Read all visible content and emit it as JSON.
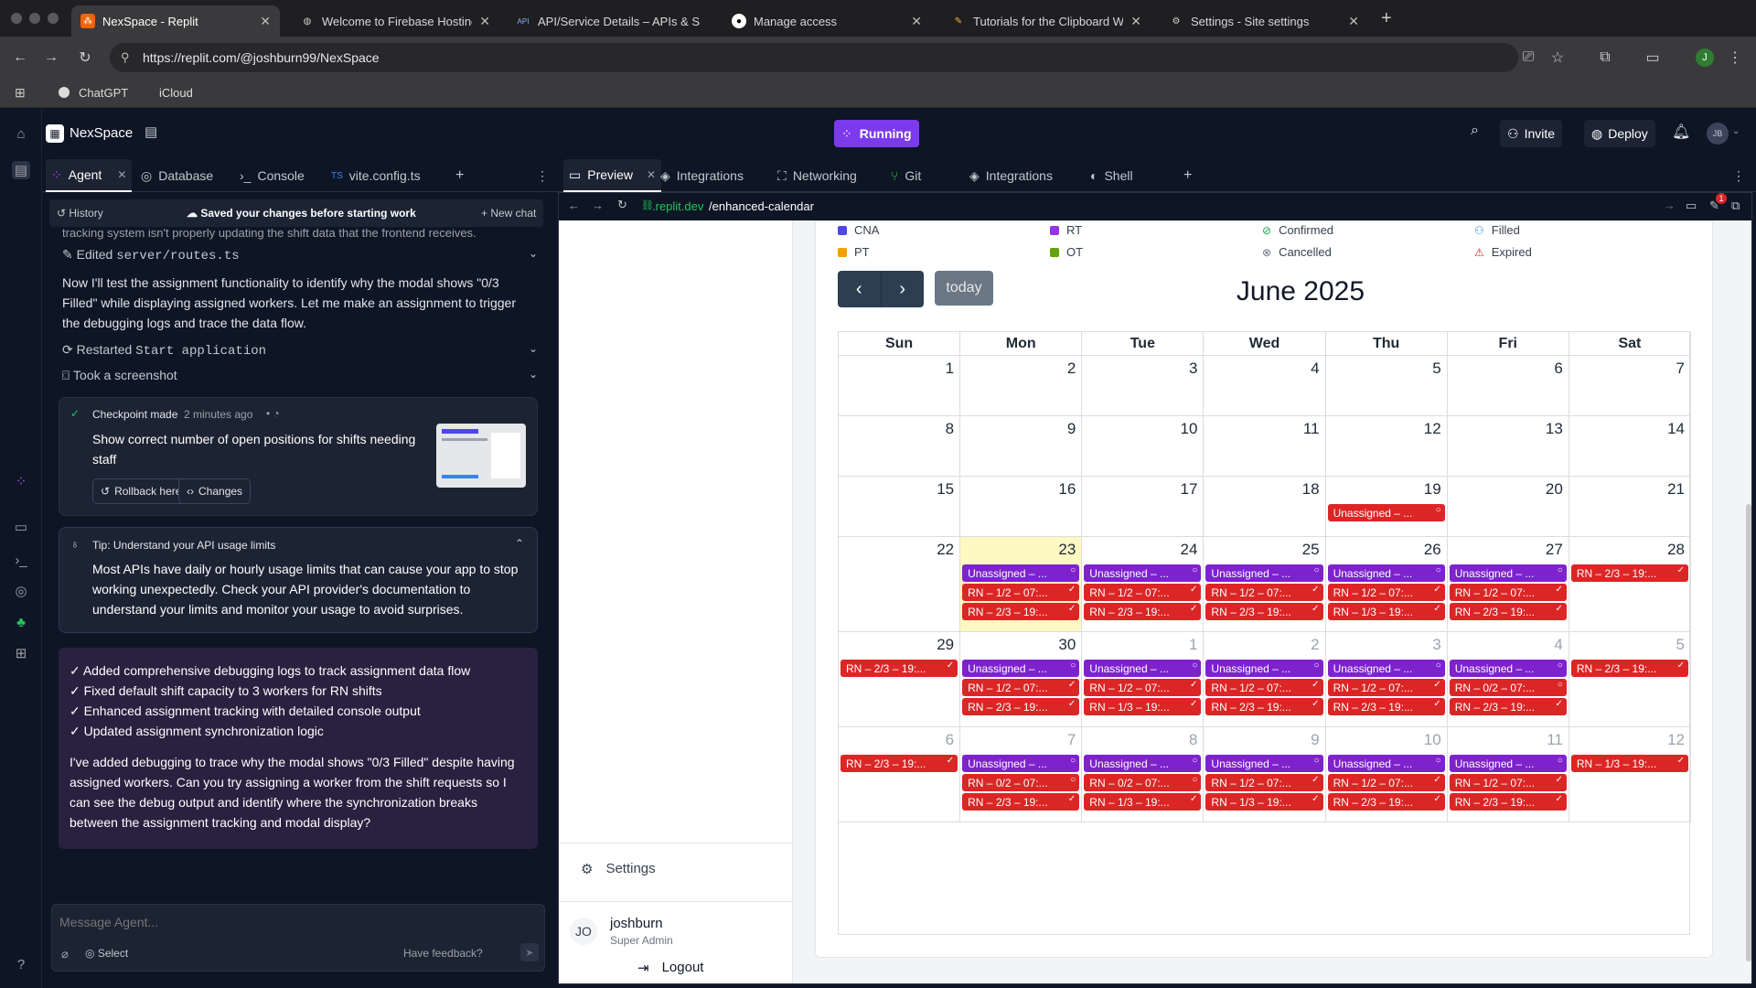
{
  "browser": {
    "tabs": [
      {
        "title": "NexSpace - Replit",
        "icon": "replit-favicon",
        "active": true
      },
      {
        "title": "Welcome to Firebase Hosting",
        "icon": "globe-icon"
      },
      {
        "title": "API/Service Details – APIs & S",
        "icon": "api-icon"
      },
      {
        "title": "Manage access",
        "icon": "github-icon"
      },
      {
        "title": "Tutorials for the Clipboard Wo",
        "icon": "tutorial-icon"
      },
      {
        "title": "Settings - Site settings",
        "icon": "gear-icon"
      }
    ],
    "url": "https://replit.com/@joshburn99/NexSpace",
    "bookmarks": [
      "ChatGPT",
      "iCloud"
    ],
    "profile_initial": "J"
  },
  "replit": {
    "project_name": "NexSpace",
    "run_status": "Running",
    "invite_label": "Invite",
    "deploy_label": "Deploy",
    "avatar_initials": "JB",
    "left_tabs": [
      "Agent",
      "Database",
      "Console",
      "vite.config.ts"
    ],
    "right_tabs": [
      "Preview",
      "Integrations",
      "Networking",
      "Git",
      "Integrations",
      "Shell"
    ]
  },
  "agent": {
    "history_label": "History",
    "saved_message": "Saved your changes before starting work",
    "new_chat_label": "New chat",
    "cutoff_text": "tracking system isn't properly updating the shift data that the frontend receives.",
    "edited_label": "Edited",
    "edited_file": "server/routes.ts",
    "paragraph1": "Now I'll test the assignment functionality to identify why the modal shows \"0/3 Filled\" while displaying assigned workers. Let me make an assignment to trigger the debugging logs and trace the data flow.",
    "restarted_label": "Restarted",
    "restarted_target": "Start application",
    "screenshot_label": "Took a screenshot",
    "checkpoint_label": "Checkpoint made",
    "checkpoint_time": "2 minutes ago",
    "checkpoint_text": "Show correct number of open positions for shifts needing staff",
    "rollback_label": "Rollback here",
    "changes_label": "Changes",
    "tip_title": "Tip: Understand your API usage limits",
    "tip_body": "Most APIs have daily or hourly usage limits that can cause your app to stop working unexpectedly. Check your API provider's documentation to understand your limits and monitor your usage to avoid surprises.",
    "summary_items": [
      "✓ Added comprehensive debugging logs to track assignment data flow",
      "✓ Fixed default shift capacity to 3 workers for RN shifts",
      "✓ Enhanced assignment tracking with detailed console output",
      "✓ Updated assignment synchronization logic"
    ],
    "summary_paragraph": "I've added debugging to trace why the modal shows \"0/3 Filled\" despite having assigned workers. Can you try assigning a worker from the shift requests so I can see the debug output and identify where the synchronization breaks between the assignment tracking and modal display?",
    "input_placeholder": "Message Agent...",
    "select_label": "Select",
    "feedback_label": "Have feedback?"
  },
  "preview": {
    "url_prefix": ".replit.dev",
    "url_path": "/enhanced-calendar",
    "sidebar": {
      "settings_label": "Settings",
      "user_initials": "JO",
      "user_name": "joshburn",
      "user_role": "Super Admin",
      "logout_label": "Logout"
    },
    "legend": [
      {
        "label": "CNA",
        "color": "#4f46e5"
      },
      {
        "label": "RT",
        "color": "#9333ea"
      },
      {
        "label": "Confirmed",
        "icon": "check-circle-icon"
      },
      {
        "label": "Filled",
        "icon": "user-check-icon"
      },
      {
        "label": "PT",
        "color": "#f59e0b"
      },
      {
        "label": "OT",
        "color": "#65a30d"
      },
      {
        "label": "Cancelled",
        "icon": "x-circle-icon"
      },
      {
        "label": "Expired",
        "icon": "warning-triangle-icon"
      }
    ],
    "calendar": {
      "title": "June 2025",
      "today_label": "today",
      "weekdays": [
        "Sun",
        "Mon",
        "Tue",
        "Wed",
        "Thu",
        "Fri",
        "Sat"
      ],
      "weeks": [
        {
          "days": [
            {
              "n": "1"
            },
            {
              "n": "2"
            },
            {
              "n": "3"
            },
            {
              "n": "4"
            },
            {
              "n": "5"
            },
            {
              "n": "6"
            },
            {
              "n": "7"
            }
          ]
        },
        {
          "days": [
            {
              "n": "8"
            },
            {
              "n": "9"
            },
            {
              "n": "10"
            },
            {
              "n": "11"
            },
            {
              "n": "12"
            },
            {
              "n": "13"
            },
            {
              "n": "14"
            }
          ]
        },
        {
          "days": [
            {
              "n": "15"
            },
            {
              "n": "16"
            },
            {
              "n": "17"
            },
            {
              "n": "18"
            },
            {
              "n": "19",
              "events": [
                {
                  "t": "Unassigned – ...",
                  "c": "red",
                  "m": "○"
                }
              ]
            },
            {
              "n": "20"
            },
            {
              "n": "21"
            }
          ]
        },
        {
          "days": [
            {
              "n": "22"
            },
            {
              "n": "23",
              "today": true,
              "events": [
                {
                  "t": "Unassigned – ...",
                  "c": "purple",
                  "m": "○"
                },
                {
                  "t": "RN – 1/2 – 07:...",
                  "c": "red",
                  "m": "✓"
                },
                {
                  "t": "RN – 2/3 – 19:...",
                  "c": "red",
                  "m": "✓"
                }
              ]
            },
            {
              "n": "24",
              "events": [
                {
                  "t": "Unassigned – ...",
                  "c": "purple",
                  "m": "○"
                },
                {
                  "t": "RN – 1/2 – 07:...",
                  "c": "red",
                  "m": "✓"
                },
                {
                  "t": "RN – 2/3 – 19:...",
                  "c": "red",
                  "m": "✓"
                }
              ]
            },
            {
              "n": "25",
              "events": [
                {
                  "t": "Unassigned – ...",
                  "c": "purple",
                  "m": "○"
                },
                {
                  "t": "RN – 1/2 – 07:...",
                  "c": "red",
                  "m": "✓"
                },
                {
                  "t": "RN – 2/3 – 19:...",
                  "c": "red",
                  "m": "✓"
                }
              ]
            },
            {
              "n": "26",
              "events": [
                {
                  "t": "Unassigned – ...",
                  "c": "purple",
                  "m": "○"
                },
                {
                  "t": "RN – 1/2 – 07:...",
                  "c": "red",
                  "m": "✓"
                },
                {
                  "t": "RN – 1/3 – 19:...",
                  "c": "red",
                  "m": "✓"
                }
              ]
            },
            {
              "n": "27",
              "events": [
                {
                  "t": "Unassigned – ...",
                  "c": "purple",
                  "m": "○"
                },
                {
                  "t": "RN – 1/2 – 07:...",
                  "c": "red",
                  "m": "✓"
                },
                {
                  "t": "RN – 2/3 – 19:...",
                  "c": "red",
                  "m": "✓"
                }
              ]
            },
            {
              "n": "28",
              "events": [
                {
                  "t": "RN – 2/3 – 19:...",
                  "c": "red",
                  "m": "✓"
                }
              ]
            }
          ]
        },
        {
          "days": [
            {
              "n": "29",
              "events": [
                {
                  "t": "RN – 2/3 – 19:...",
                  "c": "red",
                  "m": "✓"
                }
              ]
            },
            {
              "n": "30",
              "events": [
                {
                  "t": "Unassigned – ...",
                  "c": "purple",
                  "m": "○"
                },
                {
                  "t": "RN – 1/2 – 07:...",
                  "c": "red",
                  "m": "✓"
                },
                {
                  "t": "RN – 2/3 – 19:...",
                  "c": "red",
                  "m": "✓"
                }
              ]
            },
            {
              "n": "1",
              "muted": true,
              "events": [
                {
                  "t": "Unassigned – ...",
                  "c": "purple",
                  "m": "○"
                },
                {
                  "t": "RN – 1/2 – 07:...",
                  "c": "red",
                  "m": "✓"
                },
                {
                  "t": "RN – 1/3 – 19:...",
                  "c": "red",
                  "m": "✓"
                }
              ]
            },
            {
              "n": "2",
              "muted": true,
              "events": [
                {
                  "t": "Unassigned – ...",
                  "c": "purple",
                  "m": "○"
                },
                {
                  "t": "RN – 1/2 – 07:...",
                  "c": "red",
                  "m": "✓"
                },
                {
                  "t": "RN – 2/3 – 19:...",
                  "c": "red",
                  "m": "✓"
                }
              ]
            },
            {
              "n": "3",
              "muted": true,
              "events": [
                {
                  "t": "Unassigned – ...",
                  "c": "purple",
                  "m": "○"
                },
                {
                  "t": "RN – 1/2 – 07:...",
                  "c": "red",
                  "m": "✓"
                },
                {
                  "t": "RN – 2/3 – 19:...",
                  "c": "red",
                  "m": "✓"
                }
              ]
            },
            {
              "n": "4",
              "muted": true,
              "events": [
                {
                  "t": "Unassigned – ...",
                  "c": "purple",
                  "m": "○"
                },
                {
                  "t": "RN – 0/2 – 07:...",
                  "c": "red",
                  "m": "○"
                },
                {
                  "t": "RN – 2/3 – 19:...",
                  "c": "red",
                  "m": "✓"
                }
              ]
            },
            {
              "n": "5",
              "muted": true,
              "events": [
                {
                  "t": "RN – 2/3 – 19:...",
                  "c": "red",
                  "m": "✓"
                }
              ]
            }
          ]
        },
        {
          "days": [
            {
              "n": "6",
              "muted": true,
              "events": [
                {
                  "t": "RN – 2/3 – 19:...",
                  "c": "red",
                  "m": "✓"
                }
              ]
            },
            {
              "n": "7",
              "muted": true,
              "events": [
                {
                  "t": "Unassigned – ...",
                  "c": "purple",
                  "m": "○"
                },
                {
                  "t": "RN – 0/2 – 07:...",
                  "c": "red",
                  "m": "○"
                },
                {
                  "t": "RN – 2/3 – 19:...",
                  "c": "red",
                  "m": "✓"
                }
              ]
            },
            {
              "n": "8",
              "muted": true,
              "events": [
                {
                  "t": "Unassigned – ...",
                  "c": "purple",
                  "m": "○"
                },
                {
                  "t": "RN – 0/2 – 07:...",
                  "c": "red",
                  "m": "○"
                },
                {
                  "t": "RN – 1/3 – 19:...",
                  "c": "red",
                  "m": "✓"
                }
              ]
            },
            {
              "n": "9",
              "muted": true,
              "events": [
                {
                  "t": "Unassigned – ...",
                  "c": "purple",
                  "m": "○"
                },
                {
                  "t": "RN – 1/2 – 07:...",
                  "c": "red",
                  "m": "✓"
                },
                {
                  "t": "RN – 1/3 – 19:...",
                  "c": "red",
                  "m": "✓"
                }
              ]
            },
            {
              "n": "10",
              "muted": true,
              "events": [
                {
                  "t": "Unassigned – ...",
                  "c": "purple",
                  "m": "○"
                },
                {
                  "t": "RN – 1/2 – 07:...",
                  "c": "red",
                  "m": "✓"
                },
                {
                  "t": "RN – 2/3 – 19:...",
                  "c": "red",
                  "m": "✓"
                }
              ]
            },
            {
              "n": "11",
              "muted": true,
              "events": [
                {
                  "t": "Unassigned – ...",
                  "c": "purple",
                  "m": "○"
                },
                {
                  "t": "RN – 1/2 – 07:...",
                  "c": "red",
                  "m": "✓"
                },
                {
                  "t": "RN – 2/3 – 19:...",
                  "c": "red",
                  "m": "✓"
                }
              ]
            },
            {
              "n": "12",
              "muted": true,
              "events": [
                {
                  "t": "RN – 1/3 – 19:...",
                  "c": "red",
                  "m": "✓"
                }
              ]
            }
          ]
        }
      ]
    }
  }
}
